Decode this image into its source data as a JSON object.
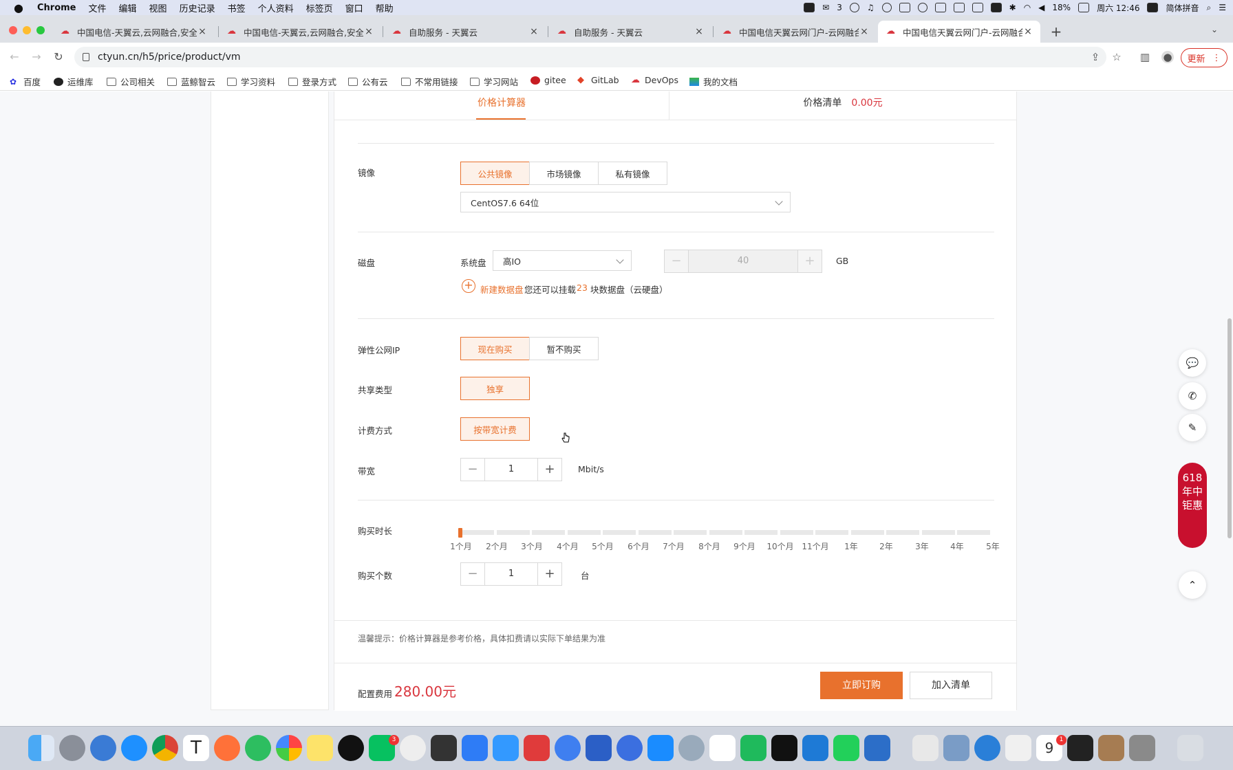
{
  "menubar": {
    "apple": "",
    "app_name": "Chrome",
    "items": [
      "文件",
      "编辑",
      "视图",
      "历史记录",
      "书签",
      "个人资料",
      "标签页",
      "窗口",
      "帮助"
    ],
    "wechat_count": "3",
    "battery": "18%",
    "datetime": "周六 12:46",
    "input_method": "简体拼音"
  },
  "browser": {
    "tabs": [
      {
        "title": "中国电信-天翼云,云网融合,安全可"
      },
      {
        "title": "中国电信-天翼云,云网融合,安全可"
      },
      {
        "title": "自助服务 - 天翼云"
      },
      {
        "title": "自助服务 - 天翼云"
      },
      {
        "title": "中国电信天翼云网门户-云网融合"
      },
      {
        "title": "中国电信天翼云网门户-云网融合"
      }
    ],
    "active_tab": 5,
    "url": "ctyun.cn/h5/price/product/vm",
    "update_label": "更新",
    "bookmarks": [
      "百度",
      "运维库",
      "公司相关",
      "蓝鲸智云",
      "学习资料",
      "登录方式",
      "公有云",
      "不常用链接",
      "学习网站",
      "gitee",
      "GitLab",
      "DevOps",
      "我的文档"
    ]
  },
  "calculator": {
    "tab_calc": "价格计算器",
    "tab_list": "价格清单",
    "list_price": "0.00元",
    "image": {
      "label": "镜像",
      "options": [
        "公共镜像",
        "市场镜像",
        "私有镜像"
      ],
      "selected": 0,
      "os": "CentOS7.6 64位"
    },
    "disk": {
      "label": "磁盘",
      "system_disk_label": "系统盘",
      "type": "高IO",
      "size": "40",
      "unit": "GB",
      "add_label": "新建数据盘",
      "hint_prefix": "您还可以挂载",
      "remaining": "23",
      "hint_suffix": "块数据盘（云硬盘）"
    },
    "eip": {
      "label": "弹性公网IP",
      "options": [
        "现在购买",
        "暂不购买"
      ],
      "selected": 0
    },
    "share": {
      "label": "共享类型",
      "option": "独享"
    },
    "billing": {
      "label": "计费方式",
      "option": "按带宽计费"
    },
    "bandwidth": {
      "label": "带宽",
      "value": "1",
      "unit": "Mbit/s"
    },
    "duration": {
      "label": "购买时长",
      "ticks": [
        "1个月",
        "2个月",
        "3个月",
        "4个月",
        "5个月",
        "6个月",
        "7个月",
        "8个月",
        "9个月",
        "10个月",
        "11个月",
        "1年",
        "2年",
        "3年",
        "4年",
        "5年"
      ],
      "selected_index": 0
    },
    "quantity": {
      "label": "购买个数",
      "value": "1",
      "unit": "台"
    },
    "tip": "温馨提示：价格计算器是参考价格，具体扣费请以实际下单结果为准",
    "fee_label": "配置费用",
    "fee_value": "280.00元",
    "order_label": "立即订购",
    "cart_label": "加入清单"
  },
  "promo": "618年中钜惠",
  "dock": {
    "wechat_badge": "3",
    "calendar_badge": "1",
    "calendar_day": "9"
  },
  "colors": {
    "accent": "#e8712d",
    "price_red": "#d9363e",
    "promo_red": "#c8102e"
  }
}
